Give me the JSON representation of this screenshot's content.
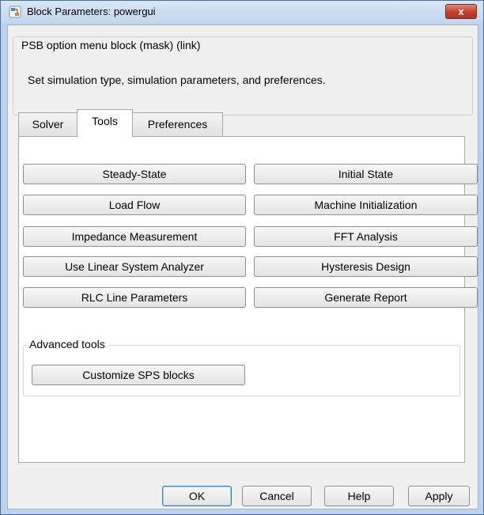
{
  "window": {
    "title": "Block Parameters: powergui",
    "close_glyph": "x"
  },
  "mask": {
    "legend": "PSB option menu block (mask) (link)",
    "description": "Set simulation type, simulation parameters, and preferences."
  },
  "tabs": [
    {
      "label": "Solver",
      "selected": false
    },
    {
      "label": "Tools",
      "selected": true
    },
    {
      "label": "Preferences",
      "selected": false
    }
  ],
  "tools": {
    "buttons_left": [
      "Steady-State",
      "Load Flow",
      "Impedance Measurement",
      "Use Linear System Analyzer",
      "RLC Line Parameters"
    ],
    "buttons_right": [
      "Initial State",
      "Machine Initialization",
      "FFT Analysis",
      "Hysteresis Design",
      "Generate Report"
    ],
    "advanced": {
      "legend": "Advanced tools",
      "button": "Customize SPS blocks"
    }
  },
  "footer": {
    "ok": "OK",
    "cancel": "Cancel",
    "help": "Help",
    "apply": "Apply"
  },
  "colors": {
    "window_frame": "#bcd3ec",
    "close_button": "#c3402a",
    "default_button_border": "#3c7fb1"
  },
  "icons": {
    "app": "simulink-block-icon",
    "close": "close-icon"
  }
}
